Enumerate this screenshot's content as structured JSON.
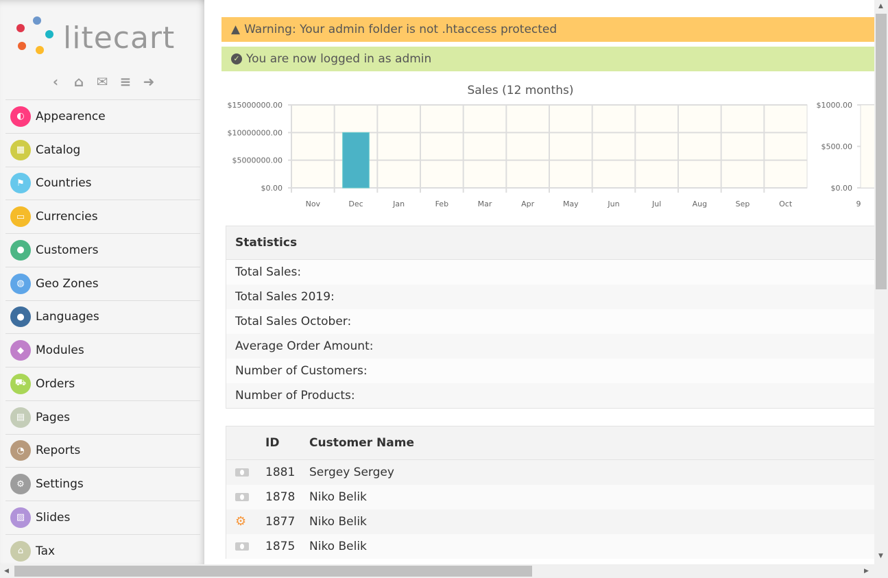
{
  "brand": {
    "name": "litecart"
  },
  "quick_links": [
    {
      "icon": "back-icon",
      "glyph": "‹"
    },
    {
      "icon": "home-icon",
      "glyph": "⌂"
    },
    {
      "icon": "mail-icon",
      "glyph": "✉"
    },
    {
      "icon": "database-icon",
      "glyph": "≡"
    },
    {
      "icon": "logout-icon",
      "glyph": "➜"
    }
  ],
  "sidebar": {
    "items": [
      {
        "label": "Appearence",
        "icon": "adjust-icon",
        "color": "#ff3b7f",
        "glyph": "◐"
      },
      {
        "label": "Catalog",
        "icon": "grid-icon",
        "color": "#cfcc47",
        "glyph": "▦"
      },
      {
        "label": "Countries",
        "icon": "flag-icon",
        "color": "#67c8ec",
        "glyph": "⚑"
      },
      {
        "label": "Currencies",
        "icon": "money-icon",
        "color": "#f5bb2a",
        "glyph": "▭"
      },
      {
        "label": "Customers",
        "icon": "user-icon",
        "color": "#4cb685",
        "glyph": "●"
      },
      {
        "label": "Geo Zones",
        "icon": "globe-icon",
        "color": "#5fa6e8",
        "glyph": "◍"
      },
      {
        "label": "Languages",
        "icon": "comments-icon",
        "color": "#3e6e9e",
        "glyph": "●"
      },
      {
        "label": "Modules",
        "icon": "cube-icon",
        "color": "#c07fca",
        "glyph": "◆"
      },
      {
        "label": "Orders",
        "icon": "cart-icon",
        "color": "#a9d657",
        "glyph": "⛟"
      },
      {
        "label": "Pages",
        "icon": "file-icon",
        "color": "#c4cdb8",
        "glyph": "▤"
      },
      {
        "label": "Reports",
        "icon": "pie-chart-icon",
        "color": "#b89a7c",
        "glyph": "◔"
      },
      {
        "label": "Settings",
        "icon": "gears-icon",
        "color": "#9d9d9d",
        "glyph": "⚙"
      },
      {
        "label": "Slides",
        "icon": "image-icon",
        "color": "#b193d9",
        "glyph": "▨"
      },
      {
        "label": "Tax",
        "icon": "bank-icon",
        "color": "#c9ccaa",
        "glyph": "⌂"
      }
    ]
  },
  "alerts": {
    "warning": "Warning: Your admin folder is not .htaccess protected",
    "success": "You are now logged in as admin",
    "warning_color": "#ffc966",
    "success_color": "#d8eba4"
  },
  "chart_data": {
    "type": "bar",
    "title": "Sales (12 months)",
    "categories": [
      "Nov",
      "Dec",
      "Jan",
      "Feb",
      "Mar",
      "Apr",
      "May",
      "Jun",
      "Jul",
      "Aug",
      "Sep",
      "Oct"
    ],
    "values": [
      0,
      10000000,
      0,
      0,
      0,
      0,
      0,
      0,
      0,
      0,
      0,
      0
    ],
    "ylim": [
      0,
      15000000
    ],
    "yticks": [
      "$0.00",
      "$5000000.00",
      "$10000000.00",
      "$15000000.00"
    ],
    "bar_color": "#4bb3c6",
    "secondary": {
      "yticks": [
        "$0.00",
        "$500.00",
        "$1000.00"
      ],
      "ylim": [
        0,
        1000
      ],
      "first_category": "9"
    }
  },
  "statistics": {
    "title": "Statistics",
    "rows": [
      "Total Sales:",
      "Total Sales 2019:",
      "Total Sales October:",
      "Average Order Amount:",
      "Number of Customers:",
      "Number of Products:"
    ]
  },
  "orders": {
    "headers": [
      "ID",
      "Customer Name"
    ],
    "rows": [
      {
        "status": "money-icon",
        "id": "1881",
        "name": "Sergey Sergey"
      },
      {
        "status": "money-icon",
        "id": "1878",
        "name": "Niko Belik"
      },
      {
        "status": "gear-icon",
        "id": "1877",
        "name": "Niko Belik"
      },
      {
        "status": "money-icon",
        "id": "1875",
        "name": "Niko Belik"
      }
    ]
  }
}
